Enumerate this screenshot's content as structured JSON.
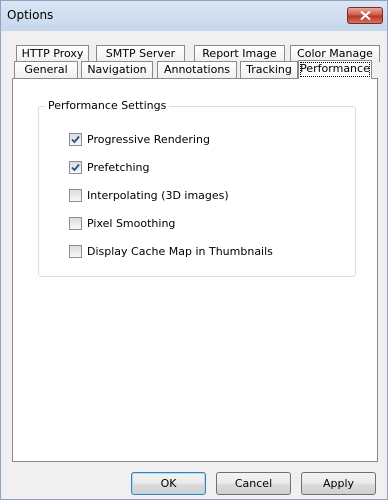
{
  "window": {
    "title": "Options"
  },
  "tabs": {
    "row1": [
      "HTTP Proxy",
      "SMTP Server",
      "Report Image",
      "Color Manage"
    ],
    "row2": [
      "General",
      "Navigation",
      "Annotations",
      "Tracking",
      "Performance"
    ],
    "active": "Performance"
  },
  "performance": {
    "group_title": "Performance Settings",
    "options": [
      {
        "label": "Progressive Rendering",
        "checked": true
      },
      {
        "label": "Prefetching",
        "checked": true
      },
      {
        "label": "Interpolating (3D images)",
        "checked": false
      },
      {
        "label": "Pixel Smoothing",
        "checked": false
      },
      {
        "label": "Display Cache Map in Thumbnails",
        "checked": false
      }
    ]
  },
  "buttons": {
    "ok": "OK",
    "cancel": "Cancel",
    "apply": "Apply"
  },
  "icons": {
    "close": "close-icon",
    "check": "checkmark-icon"
  },
  "colors": {
    "close_button": "#c75543",
    "check_mark": "#2a4f9c"
  }
}
